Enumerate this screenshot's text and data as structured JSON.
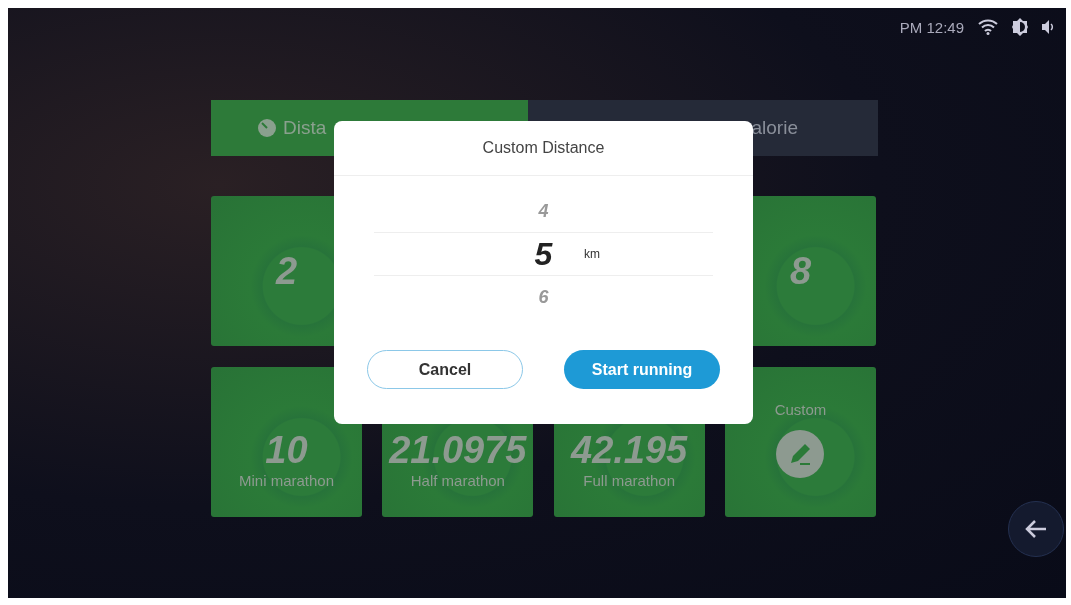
{
  "status_bar": {
    "time": "PM 12:49"
  },
  "tabs": [
    {
      "label": "Dista",
      "selected": true
    },
    {
      "label": "alorie",
      "selected": false
    }
  ],
  "tile_rows": [
    [
      {
        "kind": "value",
        "value": "2"
      },
      {
        "kind": "value",
        "value": "8"
      }
    ],
    [
      {
        "kind": "value",
        "value": "10",
        "caption": "Mini marathon"
      },
      {
        "kind": "value",
        "value": "21.0975",
        "caption": "Half marathon"
      },
      {
        "kind": "value",
        "value": "42.195",
        "caption": "Full marathon"
      },
      {
        "kind": "custom",
        "caption": "Custom"
      }
    ]
  ],
  "dialog": {
    "title": "Custom Distance",
    "options": [
      {
        "label": "4",
        "selected": false
      },
      {
        "label": "5",
        "selected": true
      },
      {
        "label": "6",
        "selected": false
      }
    ],
    "unit": "km",
    "buttons": [
      {
        "label": "Cancel",
        "kind": "secondary"
      },
      {
        "label": "Start running",
        "kind": "primary"
      }
    ]
  }
}
